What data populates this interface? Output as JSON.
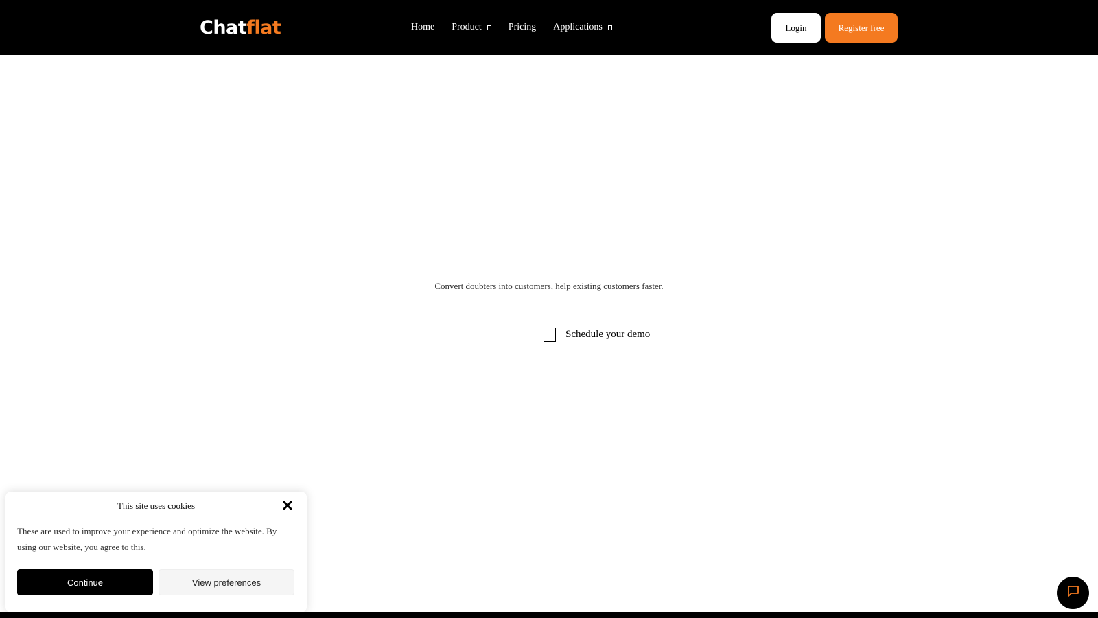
{
  "header": {
    "logo": {
      "text_main": "Chat",
      "text_accent": "flat"
    },
    "nav": [
      {
        "label": "Home",
        "has_dropdown": false
      },
      {
        "label": "Product",
        "has_dropdown": true
      },
      {
        "label": "Pricing",
        "has_dropdown": false
      },
      {
        "label": "Applications",
        "has_dropdown": true
      }
    ],
    "login_label": "Login",
    "register_label": "Register free"
  },
  "hero": {
    "tagline": "Convert doubters into customers, help existing customers faster.",
    "demo_label": "Schedule your demo"
  },
  "cookie": {
    "title": "This site uses cookies",
    "text": "These are used to improve your experience and optimize the website. By using our website, you agree to this.",
    "continue_label": "Continue",
    "preferences_label": "View preferences"
  },
  "colors": {
    "header_bg": "#000000",
    "accent": "#f47a20",
    "chat_button_bg": "#000000"
  },
  "icons": {
    "close": "close-icon",
    "chat": "chat-bubble-icon"
  }
}
